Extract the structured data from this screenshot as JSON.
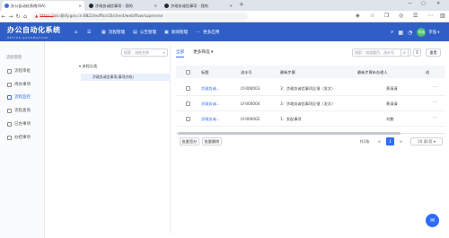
{
  "browser": {
    "tabs": [
      {
        "label": "办公自动化系统(OA)",
        "icon_color": "#3b6fd8"
      },
      {
        "label": "涉政务诚信事项 - 我的",
        "icon_color": "#24292e"
      },
      {
        "label": "涉政务诚信事项 - 我的",
        "icon_color": "#24292e"
      }
    ],
    "new_tab": "+",
    "minimize": "—",
    "maximize": "▢",
    "close": "✕",
    "back": "←",
    "forward": "→",
    "reload": "↻",
    "home": "⌂",
    "security": "▲",
    "url_prefix": "https://",
    "url": "oa.djkfy.gov.cn:8822/eoffice10/client/web/flow/supervise"
  },
  "app": {
    "title": "办公自动化系统",
    "subtitle": "OFFICE AUTOMATION",
    "nav": [
      {
        "icon": "home-icon",
        "glyph": "⌂",
        "label": ""
      },
      {
        "icon": "menu-icon",
        "glyph": "☰",
        "label": ""
      },
      {
        "icon": "flow-icon",
        "glyph": "▦",
        "label": "流程管理"
      },
      {
        "icon": "doc-icon",
        "glyph": "▤",
        "label": "公告管理"
      },
      {
        "icon": "news-icon",
        "glyph": "▣",
        "label": "新闻管理"
      },
      {
        "icon": "more-icon",
        "glyph": "⋯",
        "label": "更多应用"
      }
    ],
    "user": {
      "avatar": "李强",
      "name": "李强 ▾"
    },
    "accent": "#2f5fc6"
  },
  "sidebar": {
    "section": "流程管理",
    "items": [
      {
        "label": "流程审批",
        "active": false
      },
      {
        "label": "待办事项",
        "active": false
      },
      {
        "label": "流程监控",
        "active": true
      },
      {
        "label": "流程查询",
        "active": false
      },
      {
        "label": "已办事项",
        "active": false
      },
      {
        "label": "办结事项",
        "active": false
      }
    ]
  },
  "tree": {
    "search_placeholder": "搜索：流程名称",
    "root": "▾ 流程分类",
    "child": "涉政务诚信事项(事项办结)"
  },
  "main": {
    "tabs": [
      "全部",
      "更多筛选 ▾"
    ],
    "search_placeholder": "搜索：流程题目、流水号",
    "reset_label": "重置",
    "columns": [
      "标题",
      "流水号",
      "最新步骤",
      "最新步骤未办理人",
      "创"
    ],
    "rows": [
      {
        "title": "涉政务诚...",
        "serial": "LY-000003",
        "step": "3：涉政务诚信事项反馈（发文）",
        "pending": "黄清清"
      },
      {
        "title": "涉政务诚...",
        "serial": "LY-000004",
        "step": "3：涉政务诚信事项反馈（发文）",
        "pending": "黄清清"
      },
      {
        "title": "涉政务诚...",
        "serial": "LY-000002",
        "step": "1：发起事项",
        "pending": "刘鹏"
      }
    ],
    "batch_sign": "批量签办",
    "batch_delete": "批量删除",
    "pager": {
      "total": "共3条",
      "prev": "<",
      "current": "1",
      "next": ">",
      "page_size": "10 条/页 ▾"
    }
  }
}
